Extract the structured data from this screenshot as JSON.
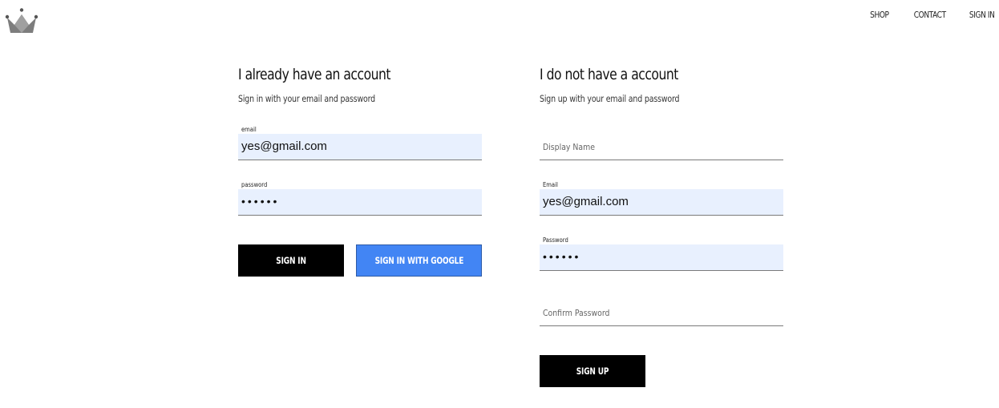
{
  "header": {
    "nav": [
      {
        "label": "SHOP"
      },
      {
        "label": "CONTACT"
      },
      {
        "label": "SIGN IN"
      }
    ]
  },
  "signin": {
    "title": "I already have an account",
    "subtitle": "Sign in with your email and password",
    "email": {
      "label": "email",
      "value": "yes@gmail.com"
    },
    "password": {
      "label": "password",
      "value": "••••••"
    },
    "signin_button": "SIGN IN",
    "google_button": "SIGN IN WITH GOOGLE"
  },
  "signup": {
    "title": "I do not have a account",
    "subtitle": "Sign up with your email and password",
    "display_name": {
      "placeholder": "Display Name"
    },
    "email": {
      "label": "Email",
      "value": "yes@gmail.com"
    },
    "password": {
      "label": "Password",
      "value": "••••••"
    },
    "confirm_password": {
      "placeholder": "Confirm Password"
    },
    "signup_button": "SIGN UP"
  },
  "colors": {
    "autofill_bg": "#e8f0fe",
    "google_blue": "#4285f4",
    "button_black": "#000000"
  },
  "icons": {
    "logo": "crown-icon"
  }
}
